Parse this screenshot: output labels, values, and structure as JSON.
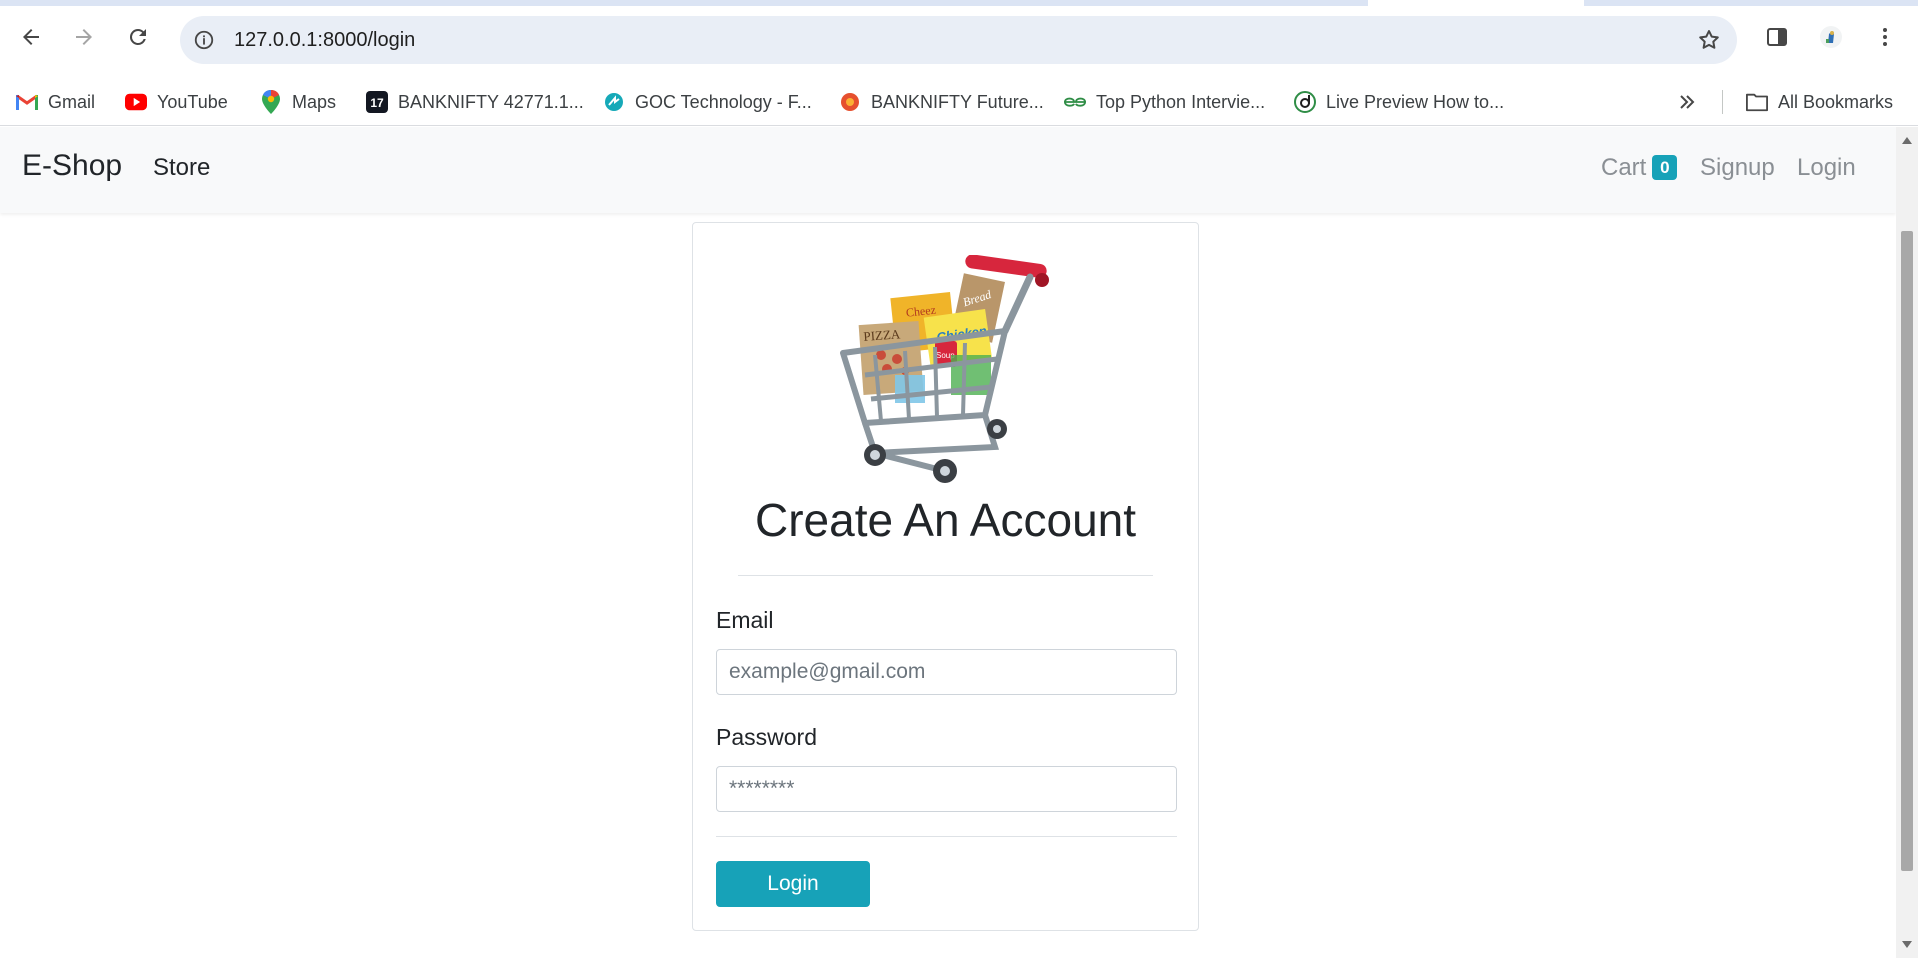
{
  "browser": {
    "url": "127.0.0.1:8000/login",
    "bookmarks": [
      {
        "label": "Gmail",
        "icon": "gmail-icon"
      },
      {
        "label": "YouTube",
        "icon": "youtube-icon"
      },
      {
        "label": "Maps",
        "icon": "maps-icon"
      },
      {
        "label": "BANKNIFTY 42771.1...",
        "icon": "tradingview-icon"
      },
      {
        "label": "GOC Technology - F...",
        "icon": "goc-icon"
      },
      {
        "label": "BANKNIFTY Future...",
        "icon": "banknifty-future-icon"
      },
      {
        "label": "Top Python Intervie...",
        "icon": "geeksforgeeks-icon"
      },
      {
        "label": "Live Preview How to...",
        "icon": "live-preview-icon"
      }
    ],
    "all_bookmarks_label": "All Bookmarks"
  },
  "navbar": {
    "brand": "E-Shop",
    "store": "Store",
    "cart": "Cart",
    "cart_count": "0",
    "signup": "Signup",
    "login": "Login"
  },
  "form": {
    "title": "Create An Account",
    "email_label": "Email",
    "email_placeholder": "example@gmail.com",
    "password_label": "Password",
    "password_placeholder": "********",
    "submit_label": "Login"
  },
  "cart_image_labels": {
    "pizza": "PIZZA",
    "chicken": "Chicken",
    "bread": "Bread",
    "soup": "Soup",
    "cheez": "Cheez"
  },
  "colors": {
    "accent": "#17a2b8",
    "navbar_bg": "#f8f9fa",
    "omnibox_bg": "#e9eef6"
  }
}
